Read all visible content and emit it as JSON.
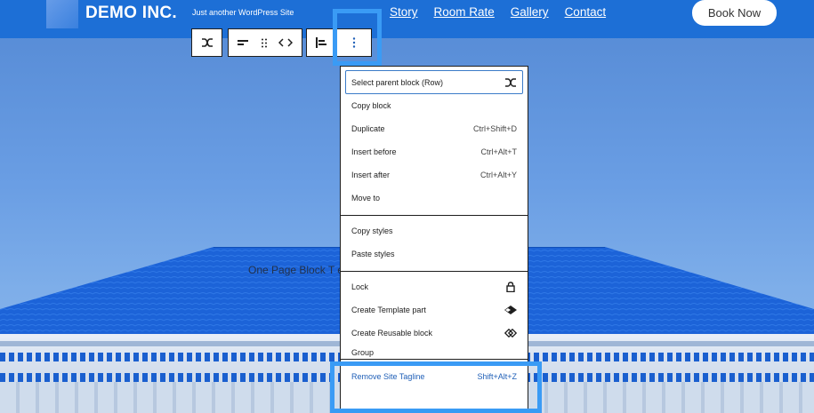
{
  "header": {
    "site_title": "DEMO INC.",
    "tagline": "Just another WordPress Site",
    "nav": [
      "Story",
      "Room Rate",
      "Gallery",
      "Contact"
    ],
    "book_button": "Book Now"
  },
  "background": {
    "text": "One Page Block T                                              ed Webs"
  },
  "toolbar": {
    "icons": [
      "transform-icon",
      "justify-icon",
      "drag-handle-icon",
      "move-arrows-icon",
      "align-icon",
      "more-options-icon"
    ]
  },
  "menu": {
    "section1": [
      {
        "label": "Select parent block (Row)",
        "shortcut_icon": "parent-icon"
      },
      {
        "label": "Copy block",
        "shortcut": ""
      },
      {
        "label": "Duplicate",
        "shortcut": "Ctrl+Shift+D"
      },
      {
        "label": "Insert before",
        "shortcut": "Ctrl+Alt+T"
      },
      {
        "label": "Insert after",
        "shortcut": "Ctrl+Alt+Y"
      },
      {
        "label": "Move to",
        "shortcut": ""
      }
    ],
    "section2": [
      {
        "label": "Copy styles"
      },
      {
        "label": "Paste styles"
      }
    ],
    "section3": [
      {
        "label": "Lock",
        "icon": "lock-icon"
      },
      {
        "label": "Create Template part",
        "icon": "template-part-icon"
      },
      {
        "label": "Create Reusable block",
        "icon": "reusable-block-icon"
      },
      {
        "label": "Group"
      }
    ],
    "section4": [
      {
        "label": "Remove Site Tagline",
        "shortcut": "Shift+Alt+Z"
      }
    ]
  },
  "colors": {
    "header_bg": "#1d6fd6",
    "highlight": "#3a9bf5",
    "roof": "#1c63d8"
  }
}
